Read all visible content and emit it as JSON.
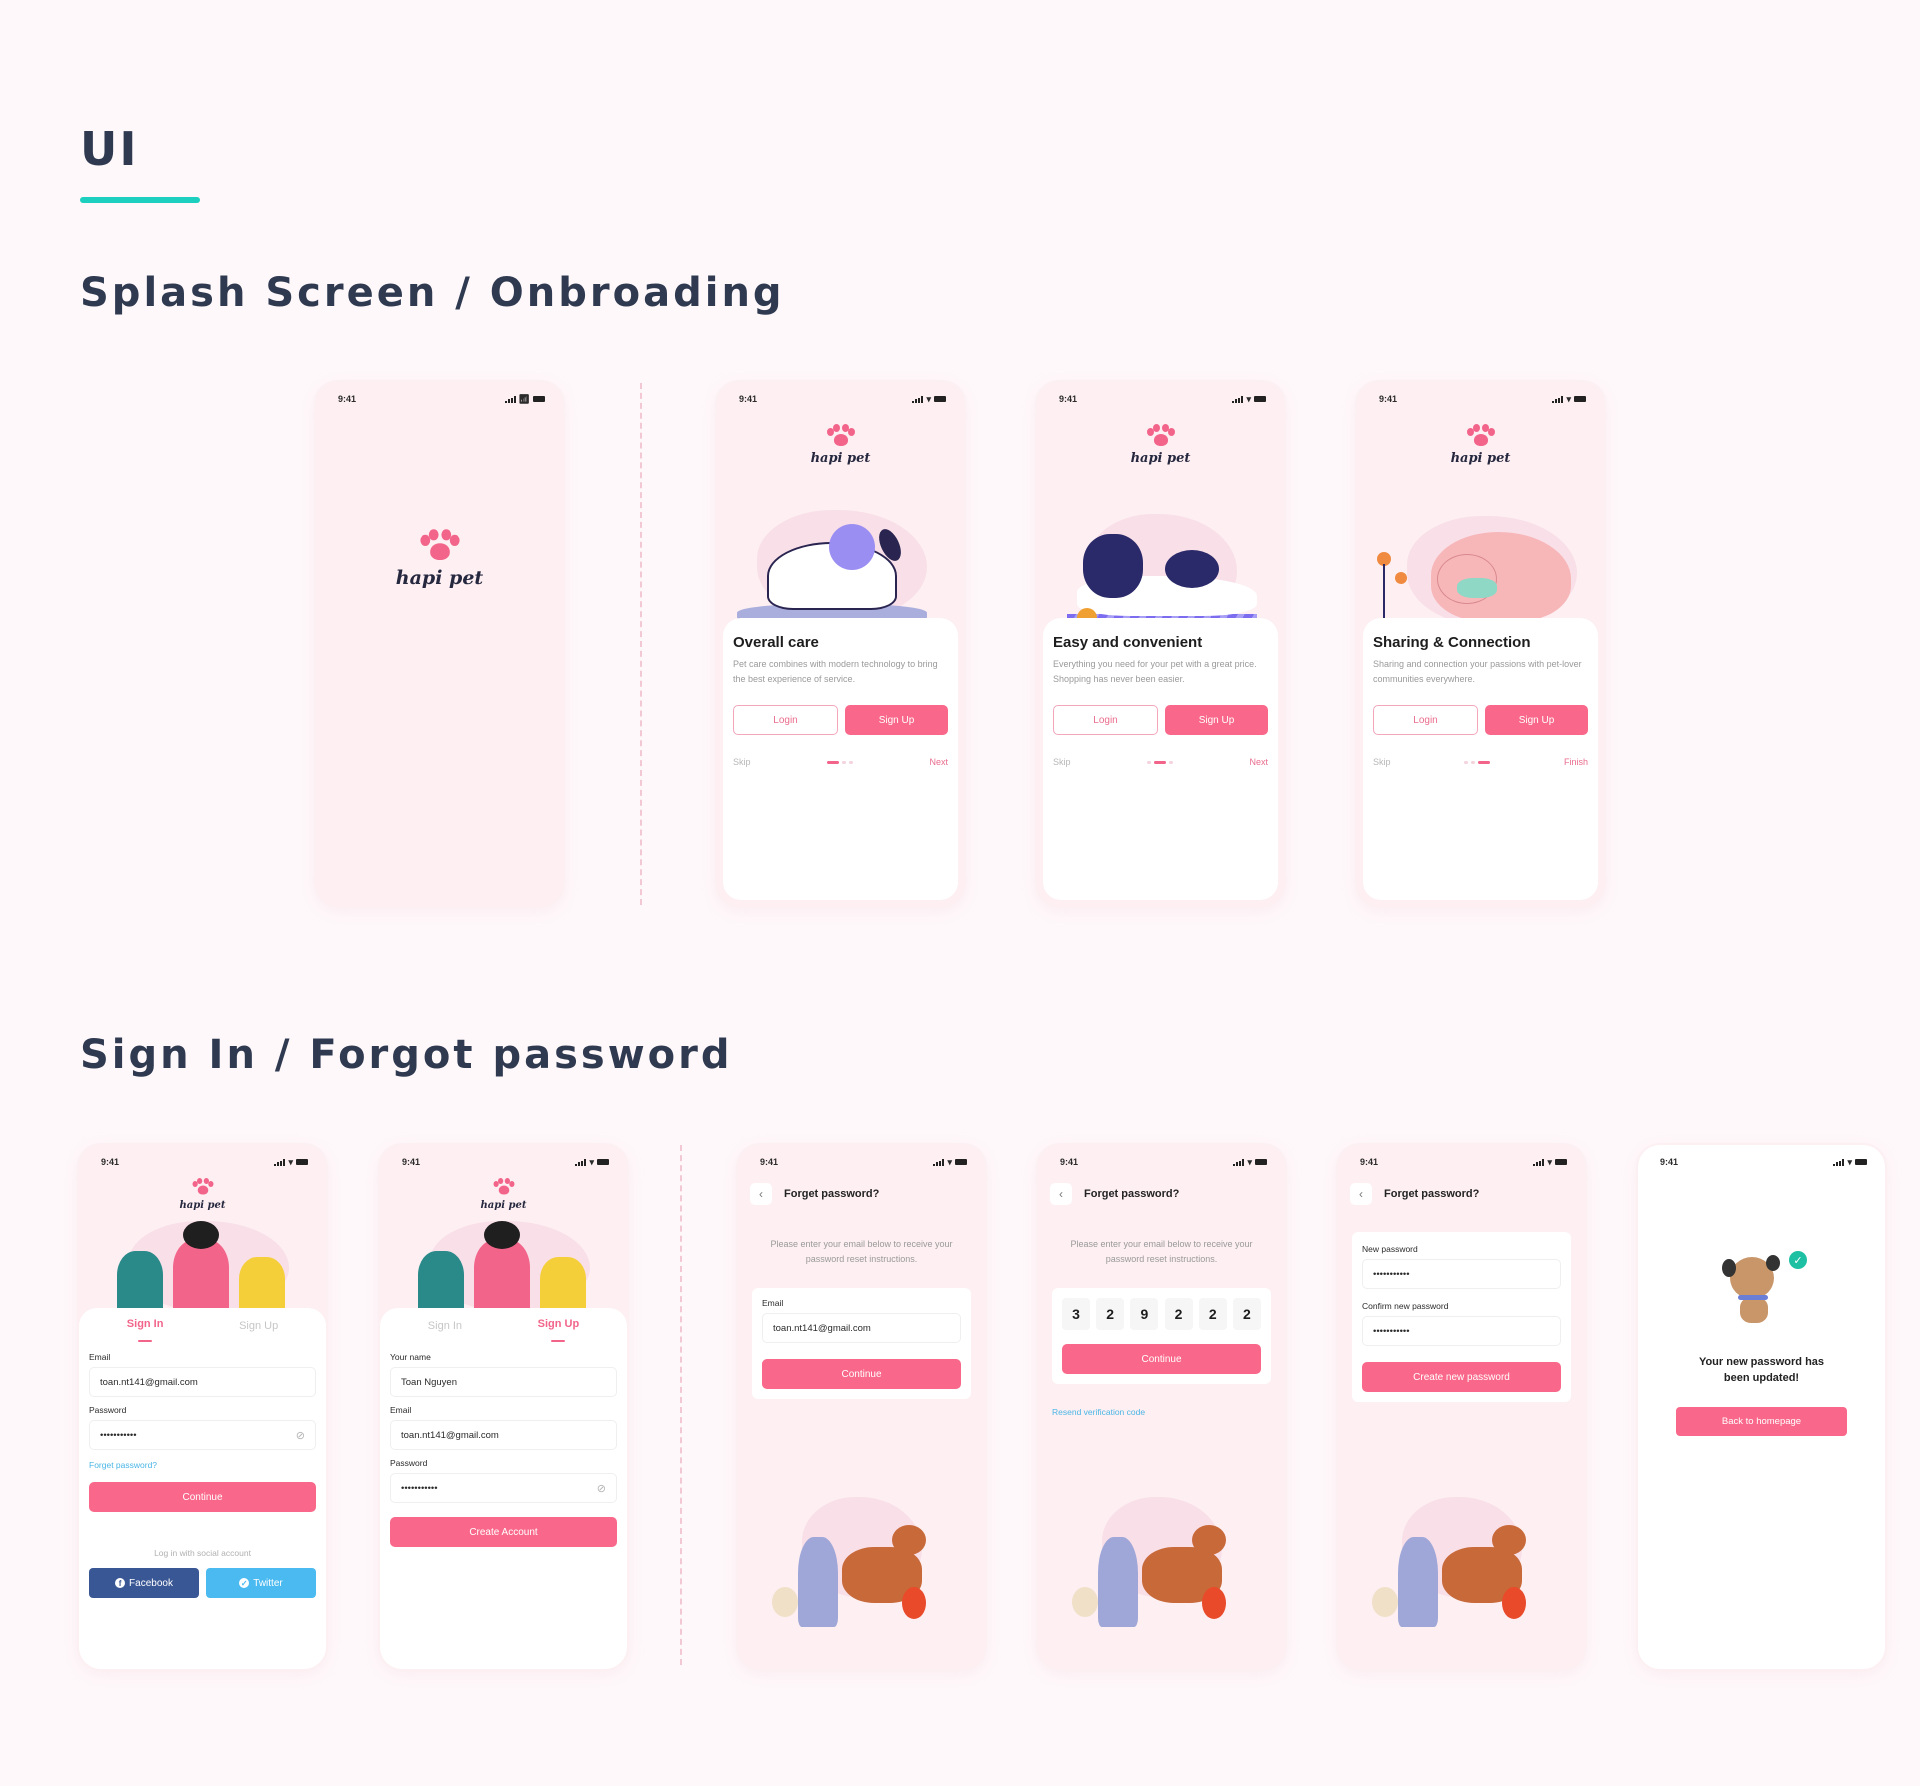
{
  "page": {
    "title": "UI",
    "accent_color": "#1ccfbf",
    "brand_color": "#f9688a"
  },
  "sections": {
    "splash_title": "Splash Screen / Onbroading",
    "auth_title": "Sign In  / Forgot password"
  },
  "status_bar": {
    "time": "9:41"
  },
  "brand": {
    "name": "hapi pet"
  },
  "onboarding": [
    {
      "title": "Overall care",
      "description": "Pet care combines with modern technology to bring the best experience of service.",
      "login_label": "Login",
      "signup_label": "Sign Up",
      "skip_label": "Skip",
      "next_label": "Next",
      "active_step": 1,
      "total_steps": 3,
      "illustration": "cat-with-yarn"
    },
    {
      "title": "Easy and convenient",
      "description": "Everything you need for your pet with a great price. Shopping has never been easier.",
      "login_label": "Login",
      "signup_label": "Sign Up",
      "skip_label": "Skip",
      "next_label": "Next",
      "active_step": 2,
      "total_steps": 3,
      "illustration": "sleeping-dog"
    },
    {
      "title": "Sharing & Connection",
      "description": "Sharing and connection your passions with pet-lover communities everywhere.",
      "login_label": "Login",
      "signup_label": "Sign Up",
      "skip_label": "Skip",
      "next_label": "Finish",
      "active_step": 3,
      "total_steps": 3,
      "illustration": "pig-with-flowers"
    }
  ],
  "sign_in": {
    "tab_signin": "Sign In",
    "tab_signup": "Sign Up",
    "email_label": "Email",
    "email_value": "toan.nt141@gmail.com",
    "password_label": "Password",
    "password_value": "•••••••••••",
    "forgot_link": "Forget password?",
    "continue_label": "Continue",
    "social_label": "Log in with social account",
    "facebook_label": "Facebook",
    "twitter_label": "Twitter"
  },
  "sign_up": {
    "tab_signin": "Sign In",
    "tab_signup": "Sign Up",
    "name_label": "Your name",
    "name_value": "Toan Nguyen",
    "email_label": "Email",
    "email_value": "toan.nt141@gmail.com",
    "password_label": "Password",
    "password_value": "•••••••••••",
    "create_label": "Create Account"
  },
  "forgot_email": {
    "title": "Forget password?",
    "description": "Please enter your email below to receive your password reset instructions.",
    "email_label": "Email",
    "email_value": "toan.nt141@gmail.com",
    "continue_label": "Continue"
  },
  "forgot_otp": {
    "title": "Forget password?",
    "description": "Please enter your email below to receive your password reset instructions.",
    "digits": [
      "3",
      "2",
      "9",
      "2",
      "2",
      "2"
    ],
    "continue_label": "Continue",
    "resend_label": "Resend verification code"
  },
  "forgot_new": {
    "title": "Forget password?",
    "new_label": "New password",
    "new_value": "•••••••••••",
    "confirm_label": "Confirm new password",
    "confirm_value": "•••••••••••",
    "create_label": "Create new password"
  },
  "done": {
    "message_line1": "Your new password has",
    "message_line2": "been updated!",
    "back_label": "Back to homepage"
  }
}
